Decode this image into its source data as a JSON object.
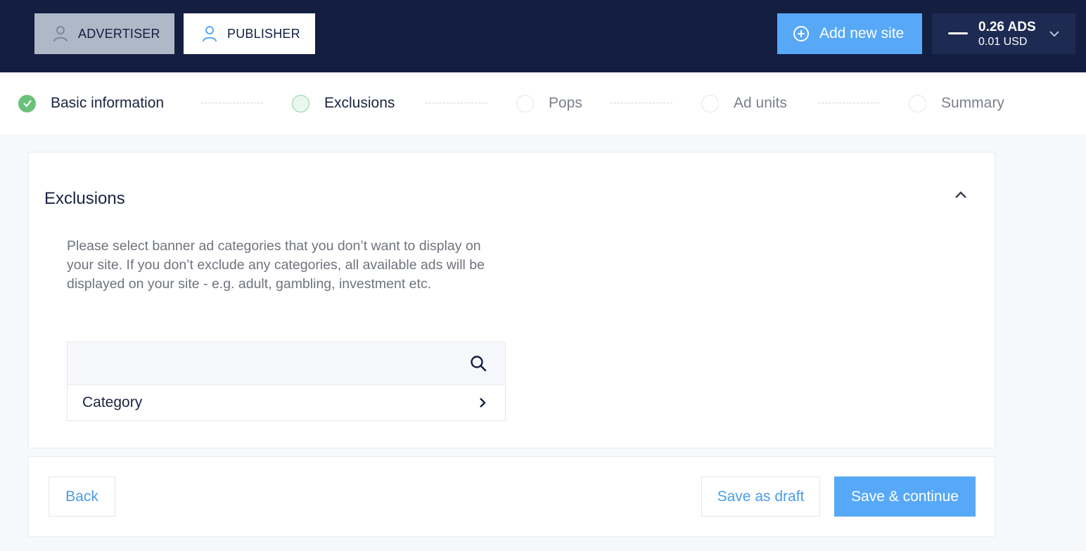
{
  "header": {
    "advertiser_label": "ADVERTISER",
    "publisher_label": "PUBLISHER",
    "add_site_label": "Add new site",
    "wallet": {
      "ads_balance": "0.26 ADS",
      "usd_balance": "0.01 USD"
    }
  },
  "steps": [
    {
      "label": "Basic information",
      "state": "done"
    },
    {
      "label": "Exclusions",
      "state": "current"
    },
    {
      "label": "Pops",
      "state": "todo"
    },
    {
      "label": "Ad units",
      "state": "todo"
    },
    {
      "label": "Summary",
      "state": "todo"
    }
  ],
  "exclusions": {
    "title": "Exclusions",
    "description": "Please select banner ad categories that you don’t want to display on your site. If you don’t exclude any categories, all available ads will be displayed on your site - e.g. adult, gambling, investment etc.",
    "search_value": "",
    "category_label": "Category"
  },
  "footer": {
    "back_label": "Back",
    "draft_label": "Save as draft",
    "save_label": "Save & continue"
  },
  "colors": {
    "header_bg": "#131e41",
    "accent": "#57a8f7",
    "success": "#6cc17a"
  }
}
